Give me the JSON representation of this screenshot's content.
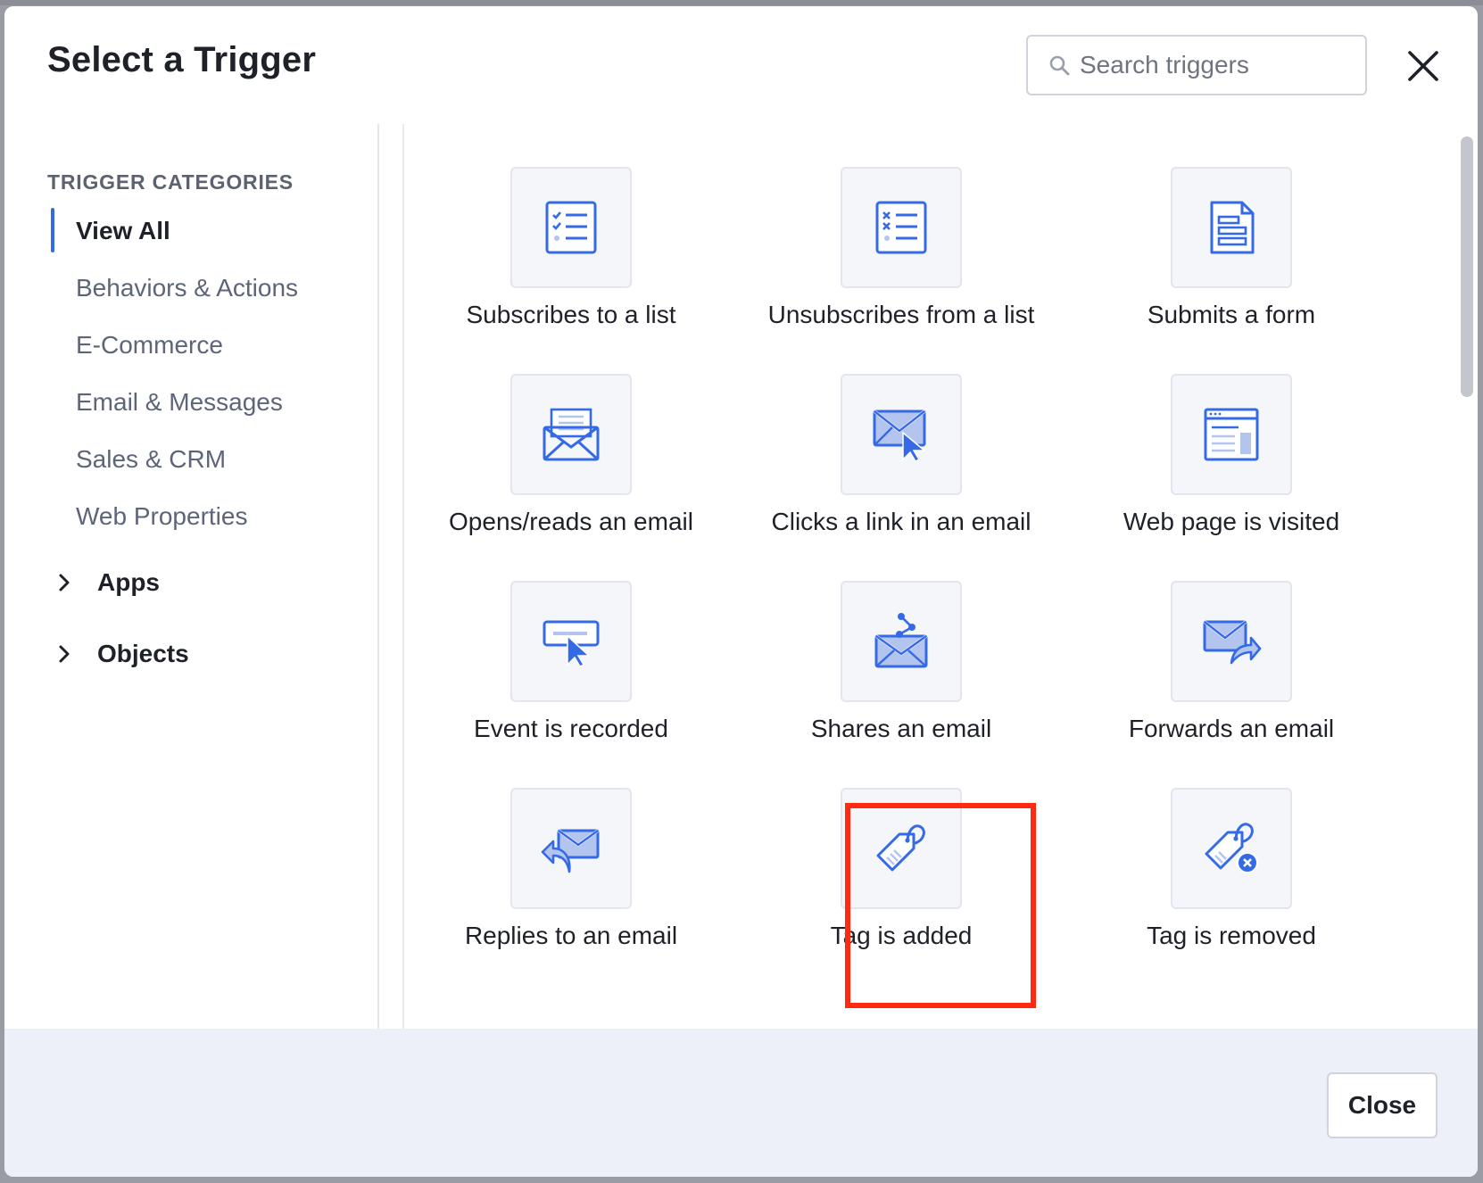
{
  "modal": {
    "title": "Select a Trigger",
    "search_placeholder": "Search triggers"
  },
  "sidebar": {
    "heading": "TRIGGER CATEGORIES",
    "categories": [
      {
        "label": "View All",
        "active": true
      },
      {
        "label": "Behaviors & Actions"
      },
      {
        "label": "E-Commerce"
      },
      {
        "label": "Email & Messages"
      },
      {
        "label": "Sales & CRM"
      },
      {
        "label": "Web Properties"
      }
    ],
    "expandable": [
      {
        "label": "Apps"
      },
      {
        "label": "Objects"
      }
    ]
  },
  "triggers": [
    {
      "label": "Subscribes to a list",
      "icon": "checklist-icon"
    },
    {
      "label": "Unsubscribes from a list",
      "icon": "x-list-icon"
    },
    {
      "label": "Submits a form",
      "icon": "form-icon"
    },
    {
      "label": "Opens/reads an email",
      "icon": "open-envelope-icon"
    },
    {
      "label": "Clicks a link in an email",
      "icon": "envelope-cursor-icon"
    },
    {
      "label": "Web page is visited",
      "icon": "web-page-icon"
    },
    {
      "label": "Event is recorded",
      "icon": "event-cursor-icon"
    },
    {
      "label": "Shares an email",
      "icon": "share-envelope-icon"
    },
    {
      "label": "Forwards an email",
      "icon": "forward-envelope-icon"
    },
    {
      "label": "Replies to an email",
      "icon": "reply-envelope-icon"
    },
    {
      "label": "Tag is added",
      "icon": "tag-icon",
      "highlighted": true
    },
    {
      "label": "Tag is removed",
      "icon": "tag-remove-icon"
    }
  ],
  "footer": {
    "close_label": "Close"
  },
  "colors": {
    "accent": "#356ae6",
    "highlight": "#ff2a10"
  }
}
